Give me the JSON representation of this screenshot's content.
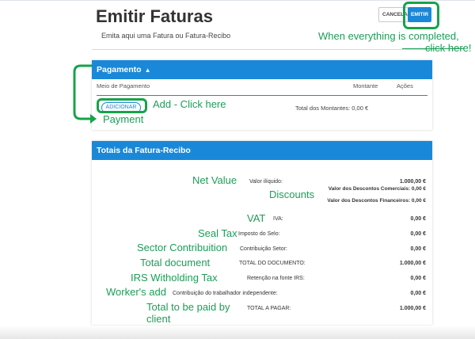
{
  "header": {
    "title": "Emitir Faturas",
    "subtitle": "Emita aqui uma Fatura ou Fatura-Recibo",
    "cancel_label": "CANCELA",
    "emit_label": "EMITIR"
  },
  "payment": {
    "title": "Pagamento",
    "columns": [
      "Meio de Pagamento",
      "Montante",
      "Ações"
    ],
    "add_label": "ADICIONAR",
    "total_amounts": "Total dos Montantes: 0,00 €"
  },
  "totals": {
    "title": "Totais da Fatura-Recibo",
    "net_value": {
      "label": "Valor ilíquido:",
      "value": "1.000,00 €"
    },
    "commercial_discounts": "Valor dos Descontos Comerciais: 0,00 €",
    "financial_discounts": "Valor dos Descontos Financeiros: 0,00 €",
    "iva": {
      "label": "IVA:",
      "value": "0,00 €"
    },
    "stamp_tax": {
      "label": "Imposto do Selo:",
      "value": "0,00 €"
    },
    "sector_contribution": {
      "label": "Contribuição Setor:",
      "value": "0,00 €"
    },
    "total_document": {
      "label": "TOTAL DO DOCUMENTO:",
      "value": "1.000,00 €"
    },
    "irs_withholding": {
      "label": "Retenção na fonte IRS:",
      "value": "0,00 €"
    },
    "worker_contribution": {
      "label": "Contribuição do trabalhador independente:",
      "value": "0,00 €"
    },
    "total_to_pay": {
      "label": "TOTAL A PAGAR:",
      "value": "1.000,00 €"
    }
  },
  "annotations": {
    "emit_note_1": "When everything is completed,",
    "emit_note_2": "click here!",
    "add_note": "Add - Click here",
    "payment_note": "Payment",
    "net_value": "Net Value",
    "discounts": "Discounts",
    "vat": "VAT",
    "seal_tax": "Seal Tax",
    "sector_contribution": "Sector Contribuition",
    "total_document": "Total document",
    "irs": "IRS Witholding Tax",
    "workers_add": "Worker's add",
    "total_paid_1": "Total to be paid by",
    "total_paid_2": "client"
  },
  "colors": {
    "primary": "#1a88d8",
    "annotation": "#1b9e57",
    "highlight": "#16a34a"
  }
}
